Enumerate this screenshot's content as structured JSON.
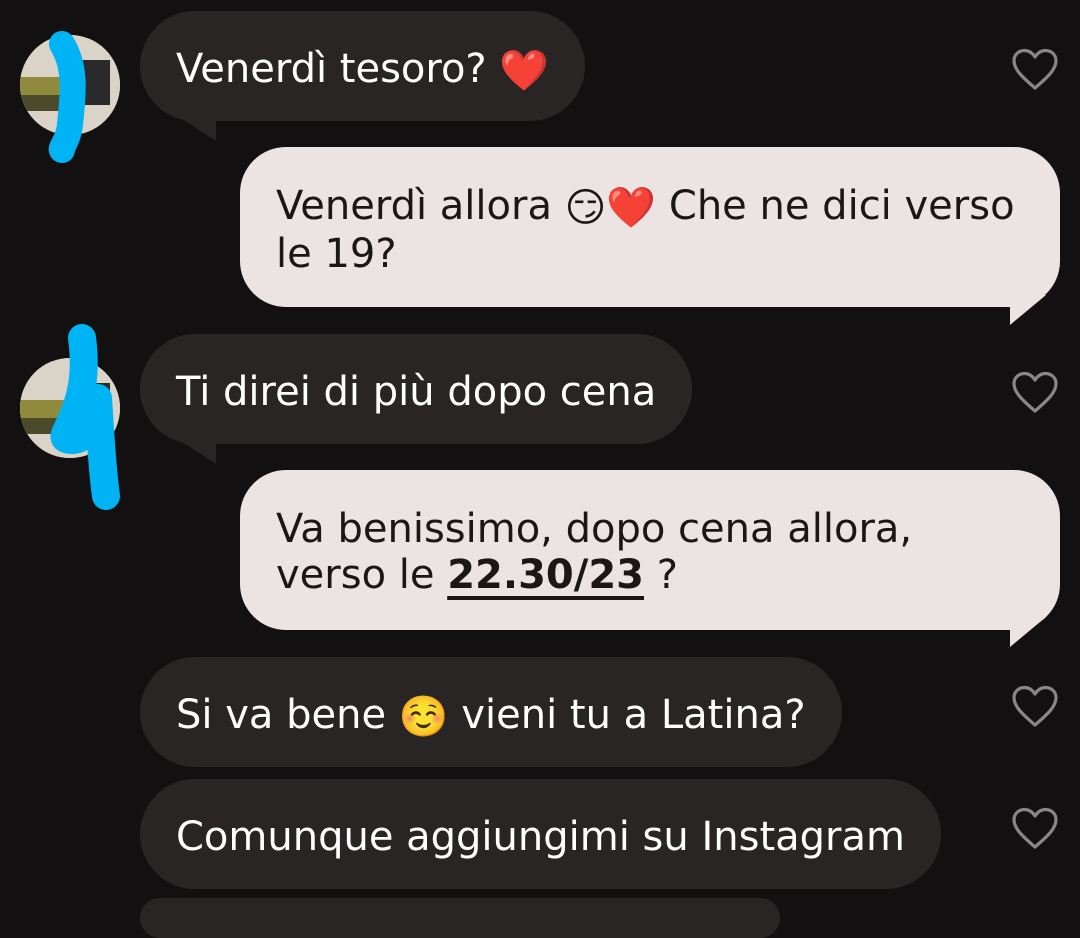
{
  "messages": [
    {
      "from": "them",
      "text": "Venerdì tesoro? ",
      "emoji": "❤️"
    },
    {
      "from": "me",
      "text_before": "Venerdì allora ",
      "emoji": "😏❤️",
      "text_after": " Che ne dici verso le 19?"
    },
    {
      "from": "them",
      "text": "Ti direi di più dopo cena"
    },
    {
      "from": "me",
      "text_before": "Va benissimo, dopo cena allora, verso le ",
      "link": "22.30/23",
      "text_after": " ?"
    },
    {
      "from": "them",
      "text_before": "Si va bene ",
      "emoji": "☺️",
      "text_after": " vieni tu a Latina?"
    },
    {
      "from": "them",
      "text": "Comunque aggiungimi su Instagram"
    }
  ],
  "colors": {
    "background": "#121010",
    "incoming_bubble": "#292525",
    "outgoing_bubble": "#ece3e3",
    "redaction": "#00b3f4"
  },
  "icons": {
    "like": "heart-outline-icon"
  }
}
